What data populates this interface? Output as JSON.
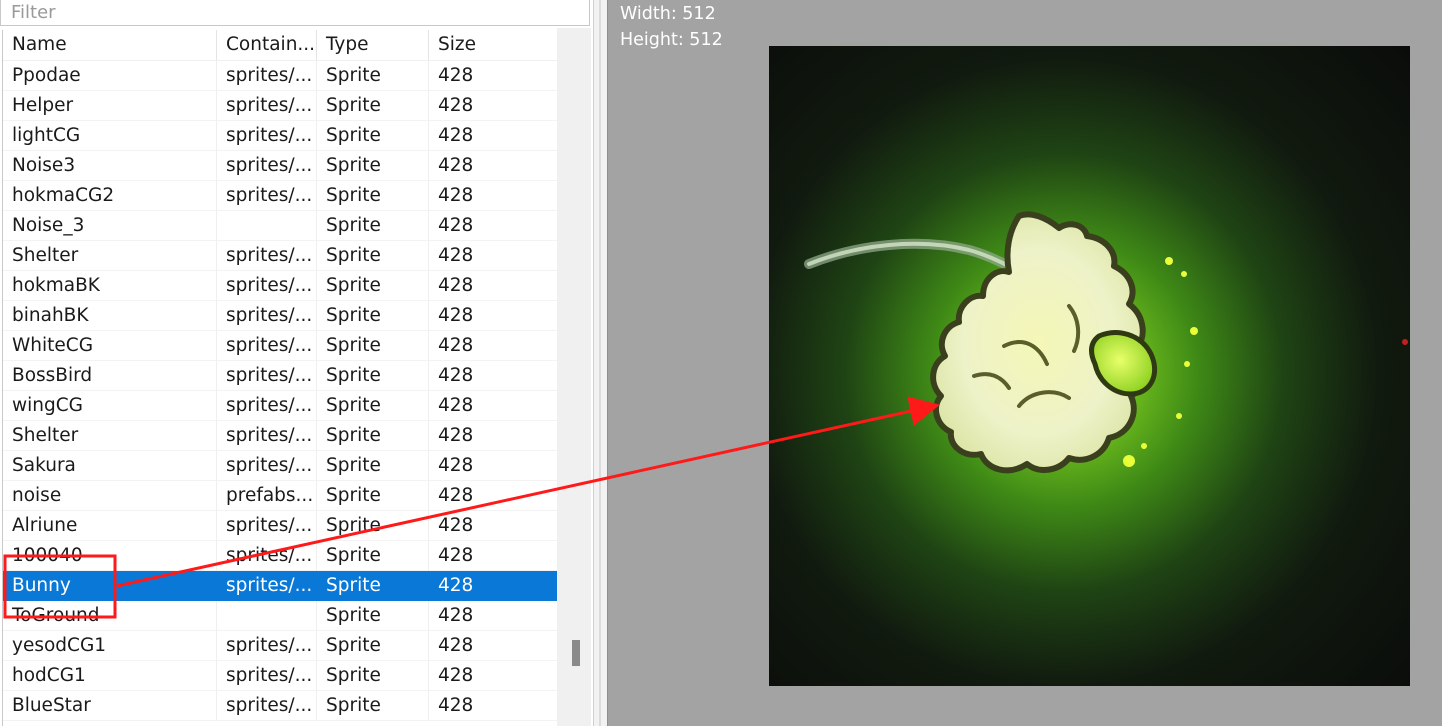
{
  "filter": {
    "placeholder": "Filter"
  },
  "columns": {
    "name": "Name",
    "container": "Contain...",
    "type": "Type",
    "size": "Size"
  },
  "rows": [
    {
      "name": "Ppodae",
      "container": "sprites/...",
      "type": "Sprite",
      "size": "428"
    },
    {
      "name": "Helper",
      "container": "sprites/...",
      "type": "Sprite",
      "size": "428"
    },
    {
      "name": "lightCG",
      "container": "sprites/...",
      "type": "Sprite",
      "size": "428"
    },
    {
      "name": "Noise3",
      "container": "sprites/...",
      "type": "Sprite",
      "size": "428"
    },
    {
      "name": "hokmaCG2",
      "container": "sprites/...",
      "type": "Sprite",
      "size": "428"
    },
    {
      "name": "Noise_3",
      "container": "",
      "type": "Sprite",
      "size": "428"
    },
    {
      "name": "Shelter",
      "container": "sprites/...",
      "type": "Sprite",
      "size": "428"
    },
    {
      "name": "hokmaBK",
      "container": "sprites/...",
      "type": "Sprite",
      "size": "428"
    },
    {
      "name": "binahBK",
      "container": "sprites/...",
      "type": "Sprite",
      "size": "428"
    },
    {
      "name": "WhiteCG",
      "container": "sprites/...",
      "type": "Sprite",
      "size": "428"
    },
    {
      "name": "BossBird",
      "container": "sprites/...",
      "type": "Sprite",
      "size": "428"
    },
    {
      "name": "wingCG",
      "container": "sprites/...",
      "type": "Sprite",
      "size": "428"
    },
    {
      "name": "Shelter",
      "container": "sprites/...",
      "type": "Sprite",
      "size": "428"
    },
    {
      "name": "Sakura",
      "container": "sprites/...",
      "type": "Sprite",
      "size": "428"
    },
    {
      "name": "noise",
      "container": "prefabs...",
      "type": "Sprite",
      "size": "428"
    },
    {
      "name": "Alriune",
      "container": "sprites/...",
      "type": "Sprite",
      "size": "428"
    },
    {
      "name": "100040",
      "container": "sprites/...",
      "type": "Sprite",
      "size": "428"
    },
    {
      "name": "Bunny",
      "container": "sprites/...",
      "type": "Sprite",
      "size": "428",
      "selected": true
    },
    {
      "name": "ToGround",
      "container": "",
      "type": "Sprite",
      "size": "428"
    },
    {
      "name": "yesodCG1",
      "container": "sprites/...",
      "type": "Sprite",
      "size": "428"
    },
    {
      "name": "hodCG1",
      "container": "sprites/...",
      "type": "Sprite",
      "size": "428"
    },
    {
      "name": "BlueStar",
      "container": "sprites/...",
      "type": "Sprite",
      "size": "428"
    }
  ],
  "preview": {
    "width_label": "Width: 512",
    "height_label": "Height: 512"
  },
  "colors": {
    "selection": "#0a78d6",
    "annotation": "#ff1a1a",
    "glow": "#9fe033"
  }
}
